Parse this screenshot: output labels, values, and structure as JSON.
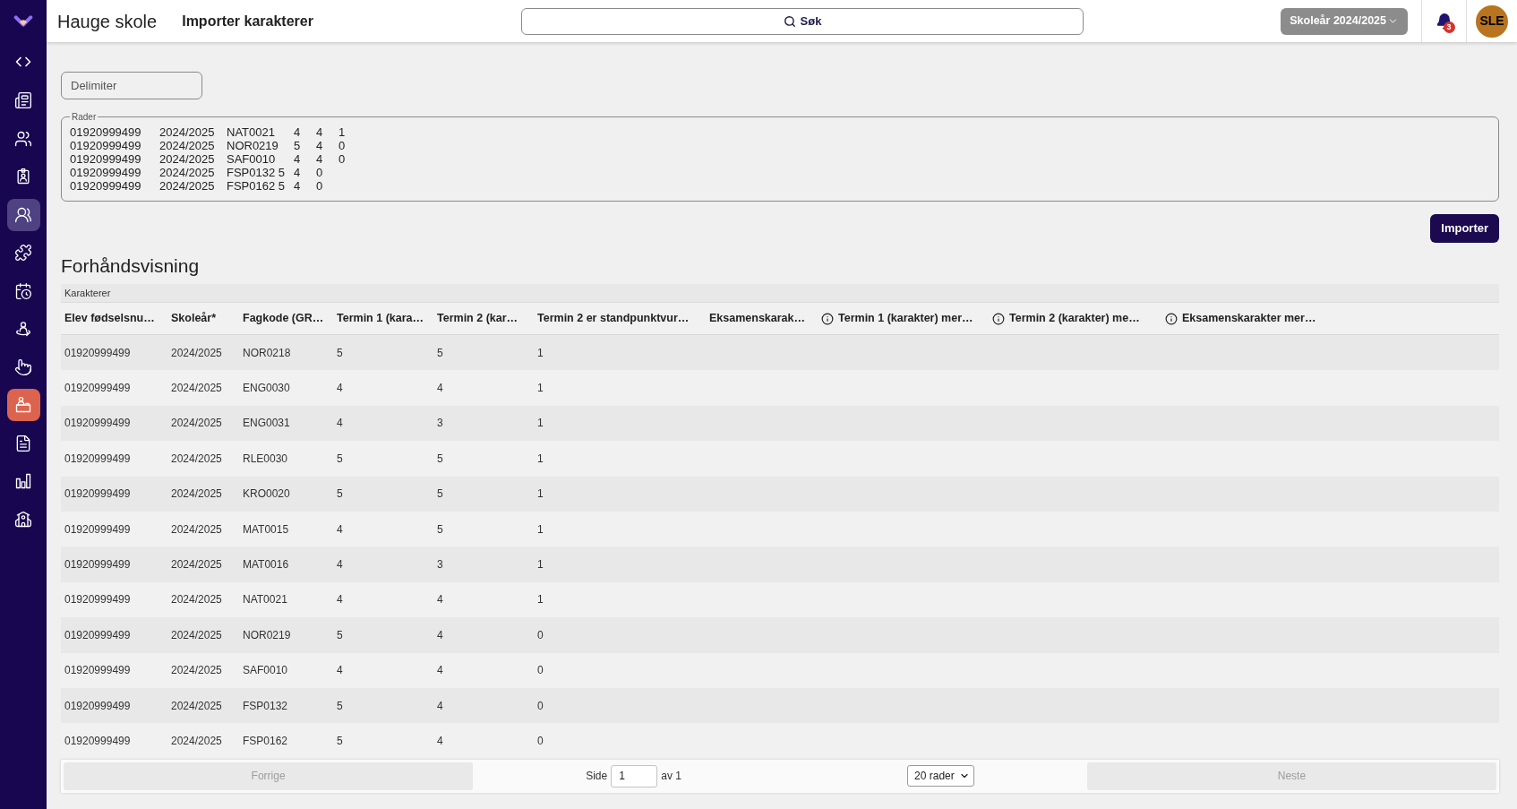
{
  "sidebar": {
    "items": [
      {
        "selected": false,
        "highlighted": false
      },
      {
        "selected": false,
        "highlighted": false
      },
      {
        "selected": false,
        "highlighted": false
      },
      {
        "selected": false,
        "highlighted": true
      },
      {
        "selected": false,
        "highlighted": false
      },
      {
        "selected": false,
        "highlighted": false
      },
      {
        "selected": false,
        "highlighted": false
      },
      {
        "selected": false,
        "highlighted": false
      },
      {
        "selected": true,
        "highlighted": false
      },
      {
        "selected": false,
        "highlighted": false
      },
      {
        "selected": false,
        "highlighted": false
      },
      {
        "selected": false,
        "highlighted": false
      }
    ]
  },
  "topbar": {
    "school": "Hauge skole",
    "page_title": "Importer karakterer",
    "search": {
      "label": "Søk"
    },
    "school_year": "Skoleår 2024/2025",
    "notifications": "3",
    "avatar": "SLE"
  },
  "form": {
    "delimiter": {
      "placeholder": "Delimiter"
    },
    "rows_field": {
      "label": "Rader",
      "lines": [
        "01920999499\t2024/2025\tNAT0021\t4\t4\t1",
        "01920999499\t2024/2025\tNOR0219\t5\t4\t0",
        "01920999499\t2024/2025\tSAF0010\t4\t4\t0",
        "01920999499\t2024/2025\tFSP0132 5\t4\t0",
        "01920999499\t2024/2025\tFSP0162 5\t4\t0"
      ]
    },
    "import_button": "Importer"
  },
  "preview": {
    "title": "Forhåndsvisning",
    "table": {
      "group_header": "Karakterer",
      "columns": [
        {
          "label": "Elev fødselsnu…",
          "info_icon": false
        },
        {
          "label": "Skoleår*",
          "info_icon": false
        },
        {
          "label": "Fagkode (GR…",
          "info_icon": false
        },
        {
          "label": "Termin 1 (kara…",
          "info_icon": false
        },
        {
          "label": "Termin 2 (kar…",
          "info_icon": false
        },
        {
          "label": "Termin 2 er standpunktvur…",
          "info_icon": false
        },
        {
          "label": "Eksamenskarak…",
          "info_icon": false
        },
        {
          "label": "Termin 1 (karakter) mer…",
          "info_icon": true
        },
        {
          "label": "Termin 2 (karakter) me…",
          "info_icon": true
        },
        {
          "label": "Eksamenskarakter mer…",
          "info_icon": true
        }
      ],
      "rows": [
        [
          "01920999499",
          "2024/2025",
          "NOR0218",
          "5",
          "5",
          "1"
        ],
        [
          "01920999499",
          "2024/2025",
          "ENG0030",
          "4",
          "4",
          "1"
        ],
        [
          "01920999499",
          "2024/2025",
          "ENG0031",
          "4",
          "3",
          "1"
        ],
        [
          "01920999499",
          "2024/2025",
          "RLE0030",
          "5",
          "5",
          "1"
        ],
        [
          "01920999499",
          "2024/2025",
          "KRO0020",
          "5",
          "5",
          "1"
        ],
        [
          "01920999499",
          "2024/2025",
          "MAT0015",
          "4",
          "5",
          "1"
        ],
        [
          "01920999499",
          "2024/2025",
          "MAT0016",
          "4",
          "3",
          "1"
        ],
        [
          "01920999499",
          "2024/2025",
          "NAT0021",
          "4",
          "4",
          "1"
        ],
        [
          "01920999499",
          "2024/2025",
          "NOR0219",
          "5",
          "4",
          "0"
        ],
        [
          "01920999499",
          "2024/2025",
          "SAF0010",
          "4",
          "4",
          "0"
        ],
        [
          "01920999499",
          "2024/2025",
          "FSP0132",
          "5",
          "4",
          "0"
        ],
        [
          "01920999499",
          "2024/2025",
          "FSP0162",
          "5",
          "4",
          "0"
        ]
      ]
    },
    "pagination": {
      "previous": {
        "label": "Forrige",
        "disabled": true
      },
      "page_label": "Side",
      "page_value": "1",
      "page_total": "av 1",
      "page_size": "20 rader",
      "next": {
        "label": "Neste",
        "disabled": true
      }
    }
  }
}
